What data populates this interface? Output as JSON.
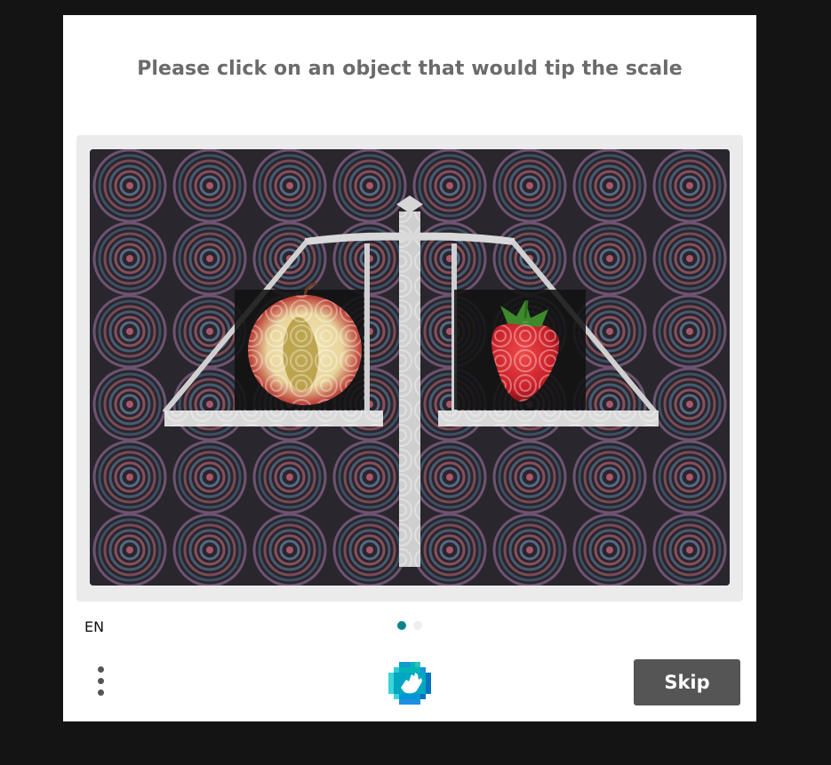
{
  "prompt": "Please click on an object that would tip the scale",
  "challenge": {
    "left_pan_object": "apple-half",
    "right_pan_object": "strawberry"
  },
  "footer": {
    "language": "EN",
    "pagination": {
      "total": 2,
      "active": 1
    },
    "menu_icon": "more-vertical-icon",
    "logo_icon": "hcaptcha-hand-icon",
    "skip_label": "Skip"
  },
  "colors": {
    "page_bg": "#141414",
    "card_bg": "#ffffff",
    "prompt_text": "#6b6b6b",
    "frame_bg": "#ebebeb",
    "dot_active": "#0f838c",
    "dot_inactive": "#eeeeee",
    "skip_bg": "#555555"
  }
}
